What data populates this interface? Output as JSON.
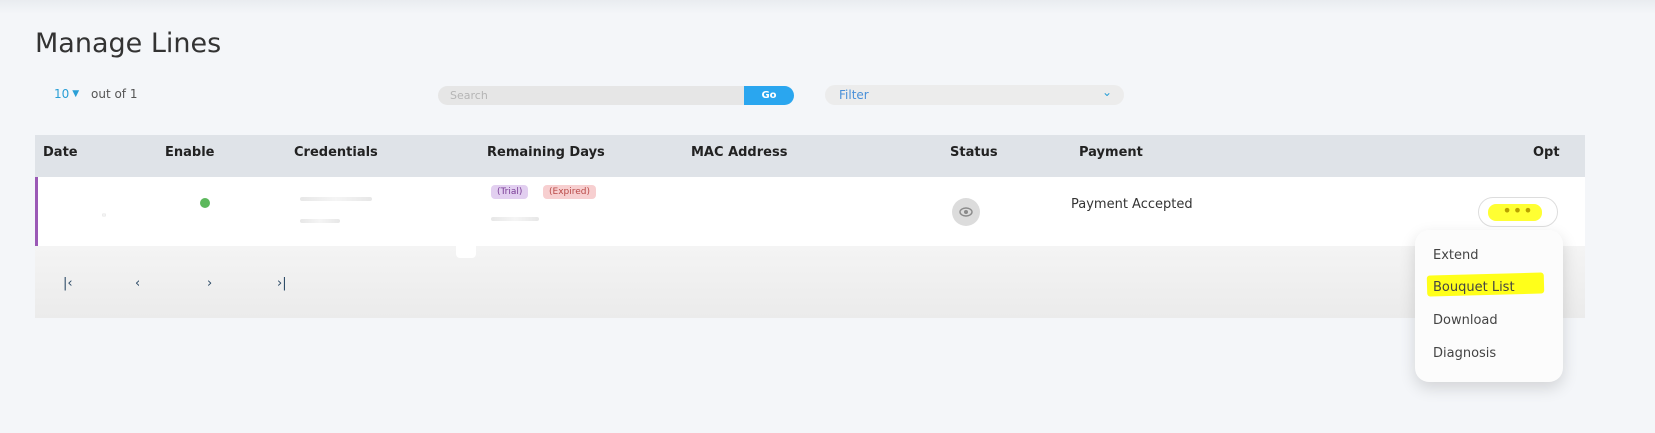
{
  "page": {
    "title": "Manage Lines"
  },
  "toolbar": {
    "page_size": "10",
    "page_size_caret": "▼",
    "out_of": "out of 1",
    "search_placeholder": "Search",
    "go_label": "Go",
    "filter_label": "Filter",
    "filter_chevron": "⌄"
  },
  "table": {
    "columns": [
      "Date",
      "Enable",
      "Credentials",
      "Remaining Days",
      "MAC Address",
      "Status",
      "Payment",
      "Opt"
    ],
    "rows": [
      {
        "remaining_badges": [
          "(Trial)",
          "(Expired)"
        ],
        "status_icon": "eye-icon",
        "payment": "Payment Accepted",
        "opt_label": "•••"
      }
    ]
  },
  "pagination": {
    "first": "|‹",
    "prev": "‹",
    "next": "›",
    "last": "›|"
  },
  "options_menu": {
    "items": [
      "Extend",
      "Bouquet List",
      "Download",
      "Diagnosis"
    ],
    "highlighted": "Bouquet List"
  },
  "colors": {
    "accent": "#2aa6ef",
    "enabled_dot": "#5cb85c",
    "highlight": "#ffff33",
    "row_marker": "#9b59b6"
  }
}
